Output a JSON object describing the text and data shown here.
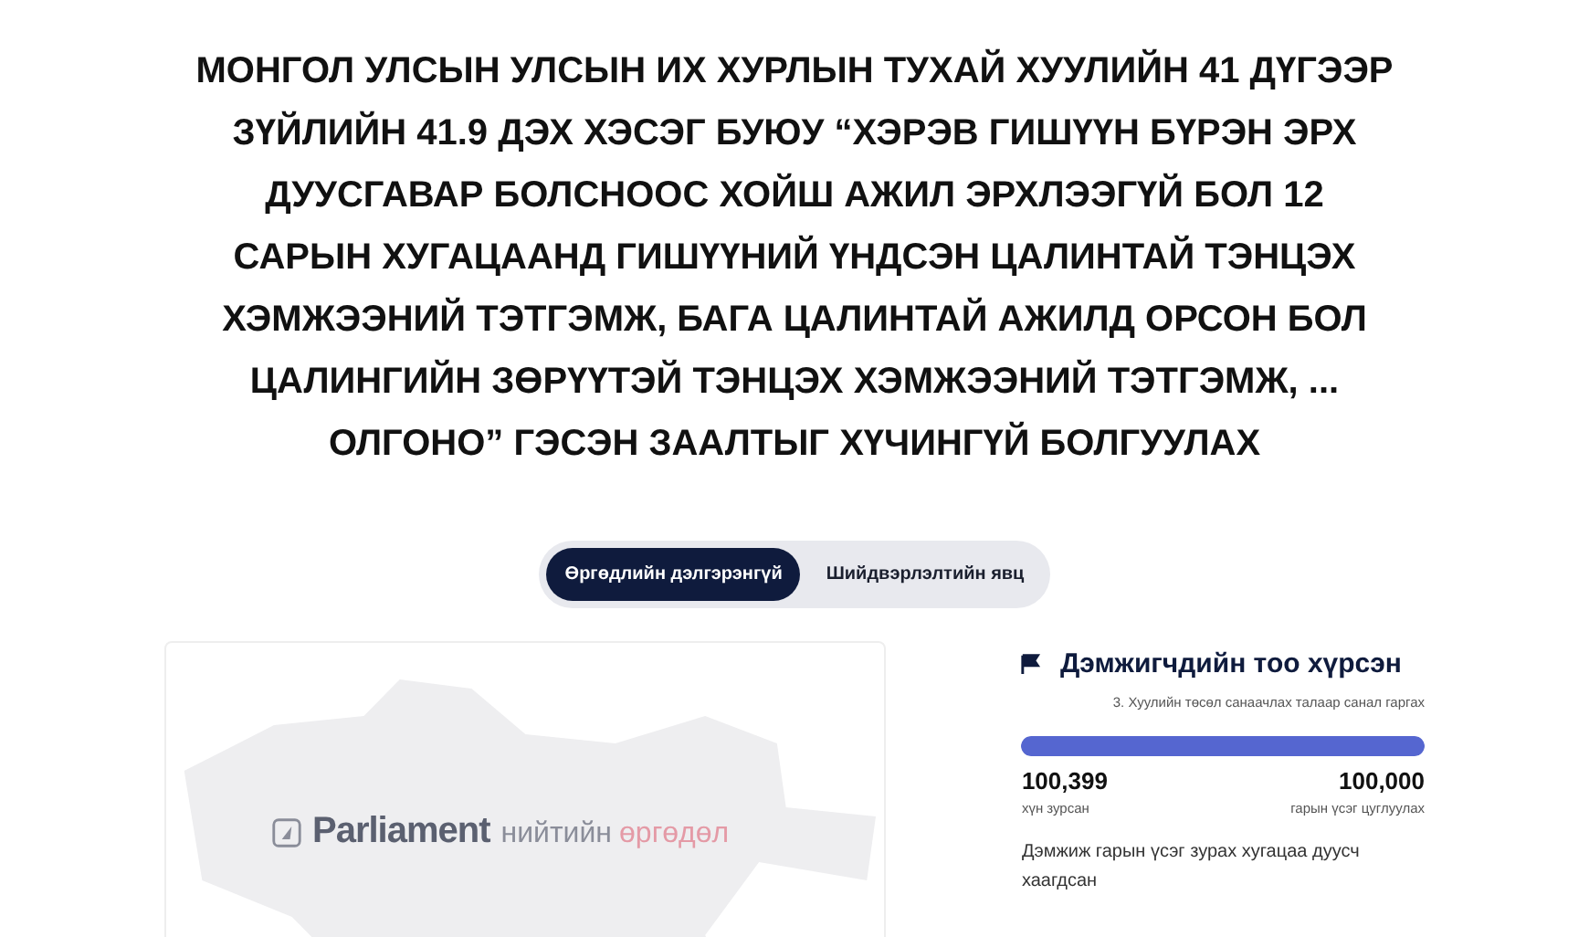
{
  "title": "МОНГОЛ УЛСЫН УЛСЫН ИХ ХУРЛЫН ТУХАЙ ХУУЛИЙН 41 ДҮГЭЭР ЗҮЙЛИЙН 41.9 ДЭХ ХЭСЭГ БУЮУ “ХЭРЭВ ГИШҮҮН БҮРЭН ЭРХ ДУУСГАВАР БОЛСНООС ХОЙШ АЖИЛ ЭРХЛЭЭГҮЙ БОЛ 12 САРЫН ХУГАЦААНД ГИШҮҮНИЙ ҮНДСЭН ЦАЛИНТАЙ ТЭНЦЭХ ХЭМЖЭЭНИЙ ТЭТГЭМЖ, БАГА ЦАЛИНТАЙ АЖИЛД ОРСОН БОЛ ЦАЛИНГИЙН ЗӨРҮҮТЭЙ ТЭНЦЭХ ХЭМЖЭЭНИЙ ТЭТГЭМЖ, ... ОЛГОНО” ГЭСЭН ЗААЛТЫГ ХҮЧИНГҮЙ БОЛГУУЛАХ",
  "tabs": [
    {
      "label": "Өргөдлийн дэлгэрэнгүй",
      "selected": true
    },
    {
      "label": "Шийдвэрлэлтийн явц",
      "selected": false
    }
  ],
  "banner": {
    "logo_word": "Parliament",
    "logo_suffix_1": "нийтийн",
    "logo_suffix_2": "өргөдөл"
  },
  "status": {
    "heading": "Дэмжигчдийн тоо хүрсэн",
    "category": "3. Хуулийн төсөл санаачлах талаар санал гаргах",
    "level": 1,
    "signed": "100,399",
    "signed_label": "хүн зурсан",
    "goal": "100,000",
    "goal_label": "гарын үсэг цуглуулах",
    "note": "Дэмжиж гарын үсэг зурах хугацаа дуусч хаагдсан"
  }
}
